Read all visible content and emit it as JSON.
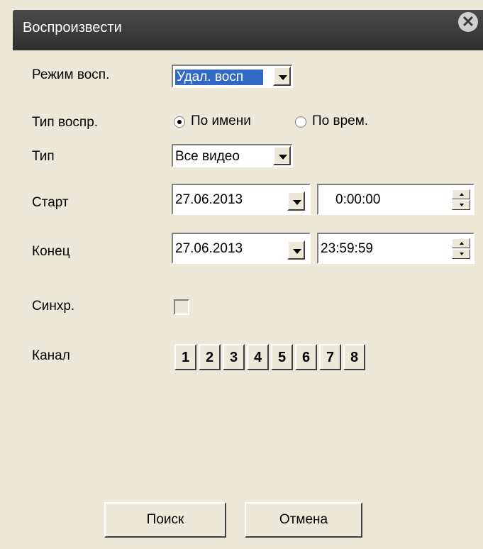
{
  "window": {
    "title": "Воспроизвести"
  },
  "form": {
    "mode": {
      "label": "Режим восп.",
      "value": "Удал. восп"
    },
    "play_type": {
      "label": "Тип воспр.",
      "option_name": "По имени",
      "option_time": "По врем.",
      "selected": "По имени"
    },
    "type": {
      "label": "Тип",
      "value": "Все видео"
    },
    "start": {
      "label": "Старт",
      "date": "27.06.2013",
      "time": "0:00:00"
    },
    "end": {
      "label": "Конец",
      "date": "27.06.2013",
      "time": "23:59:59"
    },
    "sync": {
      "label": "Синхр.",
      "checked": false
    },
    "channel": {
      "label": "Канал",
      "buttons": [
        "1",
        "2",
        "3",
        "4",
        "5",
        "6",
        "7",
        "8"
      ]
    }
  },
  "buttons": {
    "search": "Поиск",
    "cancel": "Отмена"
  }
}
